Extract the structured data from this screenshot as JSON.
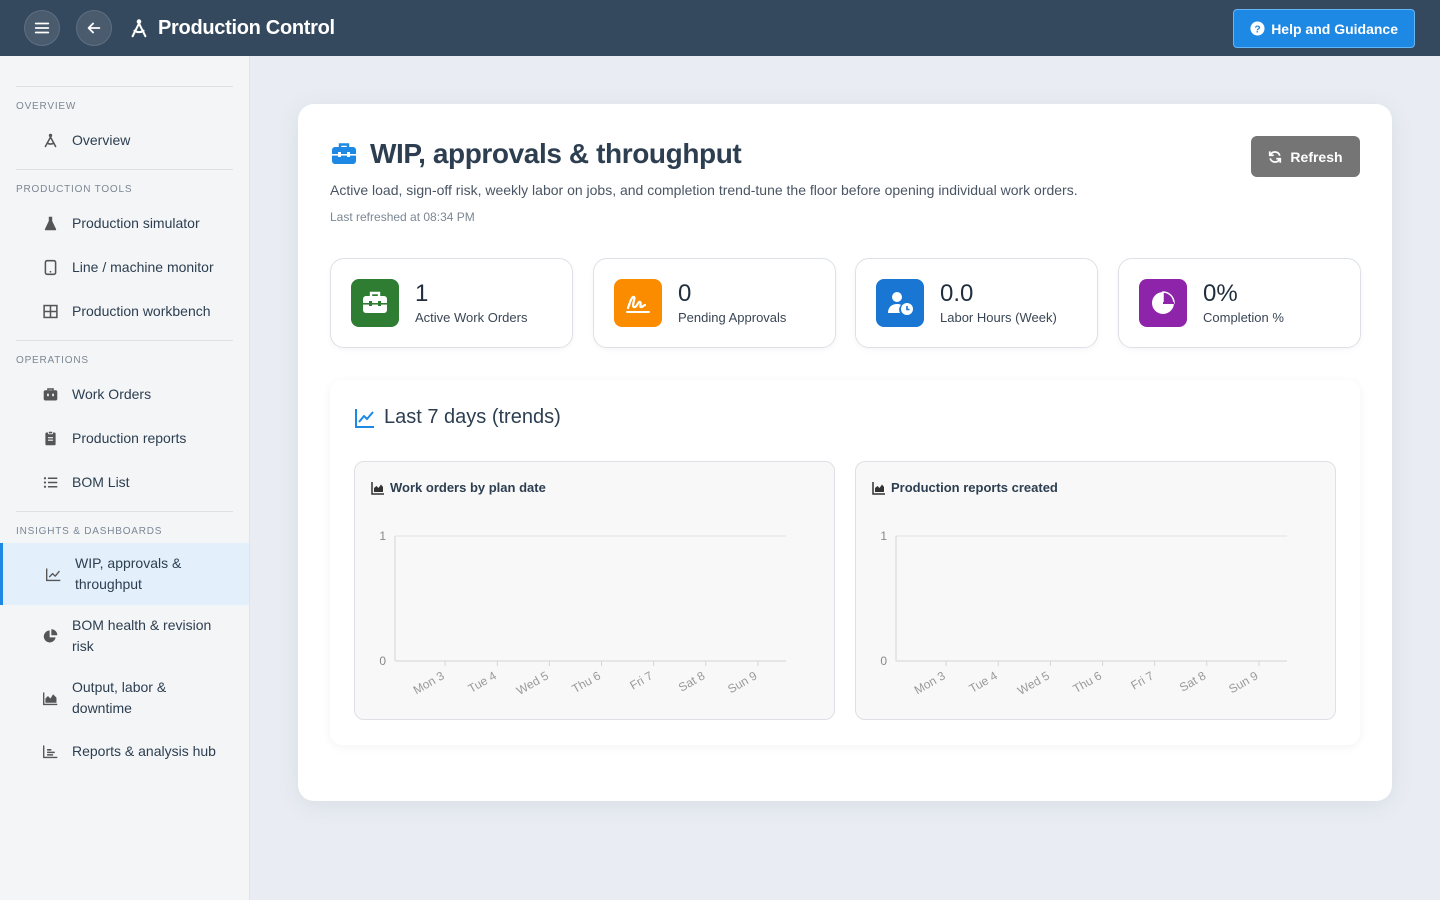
{
  "header": {
    "app_title": "Production Control",
    "help_label": "Help and Guidance"
  },
  "sidebar": {
    "sections": [
      {
        "title": "OVERVIEW",
        "items": [
          {
            "label": "Overview",
            "icon": "compass-icon"
          }
        ]
      },
      {
        "title": "PRODUCTION TOOLS",
        "items": [
          {
            "label": "Production simulator",
            "icon": "flask-icon"
          },
          {
            "label": "Line / machine monitor",
            "icon": "tablet-icon"
          },
          {
            "label": "Production workbench",
            "icon": "grid-icon"
          }
        ]
      },
      {
        "title": "OPERATIONS",
        "items": [
          {
            "label": "Work Orders",
            "icon": "toolbox-icon"
          },
          {
            "label": "Production reports",
            "icon": "clipboard-icon"
          },
          {
            "label": "BOM List",
            "icon": "list-icon"
          }
        ]
      },
      {
        "title": "INSIGHTS & DASHBOARDS",
        "items": [
          {
            "label": "WIP, approvals & throughput",
            "icon": "line-chart-icon",
            "active": true
          },
          {
            "label": "BOM health & revision risk",
            "icon": "pie-chart-icon"
          },
          {
            "label": "Output, labor & downtime",
            "icon": "area-chart-icon"
          },
          {
            "label": "Reports & analysis hub",
            "icon": "bar-chart-icon"
          }
        ]
      }
    ]
  },
  "main": {
    "title": "WIP, approvals & throughput",
    "subtitle": "Active load, sign-off risk, weekly labor on jobs, and completion trend-tune the floor before opening individual work orders.",
    "last_refreshed": "Last refreshed at 08:34 PM",
    "refresh_label": "Refresh",
    "kpis": [
      {
        "value": "1",
        "label": "Active Work Orders",
        "color": "#2e7d32",
        "icon": "toolbox-icon"
      },
      {
        "value": "0",
        "label": "Pending Approvals",
        "color": "#fb8c00",
        "icon": "signature-icon"
      },
      {
        "value": "0.0",
        "label": "Labor Hours (Week)",
        "color": "#1976d2",
        "icon": "user-clock-icon"
      },
      {
        "value": "0%",
        "label": "Completion %",
        "color": "#8e24aa",
        "icon": "pie-chart-icon"
      }
    ],
    "trends_title": "Last 7 days (trends)"
  },
  "chart_data": [
    {
      "type": "line",
      "title": "Work orders by plan date",
      "categories": [
        "Mon 3",
        "Tue 4",
        "Wed 5",
        "Thu 6",
        "Fri 7",
        "Sat 8",
        "Sun 9"
      ],
      "values": [
        0,
        0,
        0,
        0,
        0,
        0,
        0
      ],
      "ylim": [
        0,
        1
      ],
      "yticks": [
        "0",
        "1"
      ],
      "grid": true
    },
    {
      "type": "line",
      "title": "Production reports created",
      "categories": [
        "Mon 3",
        "Tue 4",
        "Wed 5",
        "Thu 6",
        "Fri 7",
        "Sat 8",
        "Sun 9"
      ],
      "values": [
        0,
        0,
        0,
        0,
        0,
        0,
        0
      ],
      "ylim": [
        0,
        1
      ],
      "yticks": [
        "0",
        "1"
      ],
      "grid": true
    }
  ]
}
